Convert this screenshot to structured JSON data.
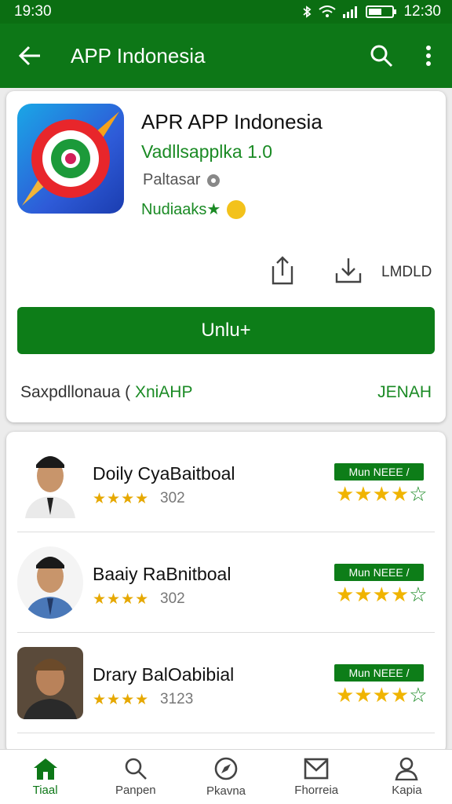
{
  "status_bar": {
    "time": "19:30",
    "clock": "12:30"
  },
  "app_bar": {
    "title": "APP Indonesia"
  },
  "app": {
    "name": "APR APP Indonesia",
    "version": "Vadllsapplka 1.0",
    "developer": "Paltasar",
    "tag": "Nudiaaks★",
    "size_label": "LMDLD",
    "primary_button": "Unlu+",
    "footer_left": "Saxpdllonaua (",
    "footer_left_accent": "XniAHP",
    "footer_right": "JENAH"
  },
  "reviews": [
    {
      "name": "Doily CyaBaitboal",
      "stars": "★★★★",
      "count": "302",
      "badge": "Mun NEEE /"
    },
    {
      "name": "Baaiy RaBnitboal",
      "stars": "★★★★",
      "count": "302",
      "badge": "Mun NEEE /"
    },
    {
      "name": "Drary BalOabibial",
      "stars": "★★★★",
      "count": "3123",
      "badge": "Mun NEEE /"
    }
  ],
  "bottom_nav": [
    {
      "label": "Tiaal",
      "icon": "home-icon"
    },
    {
      "label": "Panpen",
      "icon": "search-icon"
    },
    {
      "label": "Pkavna",
      "icon": "compass-icon"
    },
    {
      "label": "Fhorreia",
      "icon": "mail-icon"
    },
    {
      "label": "Kapia",
      "icon": "person-icon"
    }
  ],
  "colors": {
    "primary": "#0d7717",
    "accent_green": "#1a8a24",
    "star": "#f0b400"
  }
}
